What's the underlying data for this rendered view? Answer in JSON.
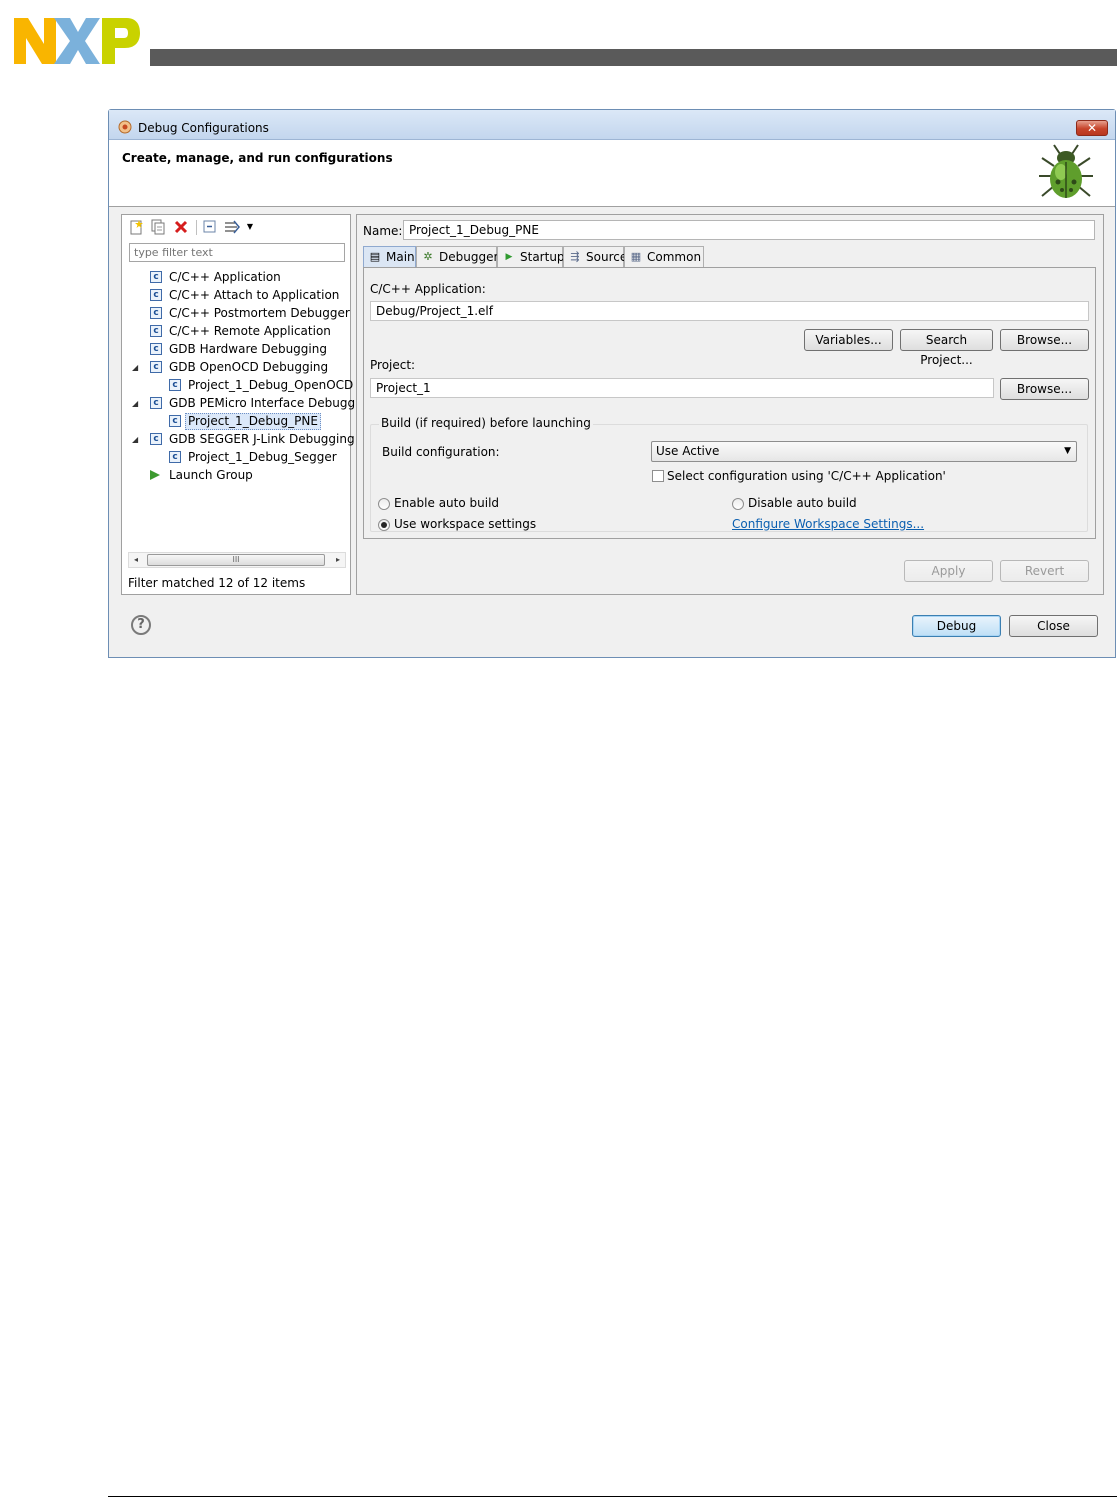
{
  "window": {
    "title": "Debug Configurations",
    "close_glyph": "✕",
    "banner_title": "Create, manage, and run configurations"
  },
  "filter": {
    "placeholder": "type filter text",
    "status": "Filter matched 12 of 12 items"
  },
  "tree": [
    {
      "label": "C/C++ Application",
      "level": 0,
      "icon": "c-config-icon",
      "expander": ""
    },
    {
      "label": "C/C++ Attach to Application",
      "level": 0,
      "icon": "c-config-icon",
      "expander": ""
    },
    {
      "label": "C/C++ Postmortem Debugger",
      "level": 0,
      "icon": "c-config-icon",
      "expander": ""
    },
    {
      "label": "C/C++ Remote Application",
      "level": 0,
      "icon": "c-config-icon",
      "expander": ""
    },
    {
      "label": "GDB Hardware Debugging",
      "level": 0,
      "icon": "c-config-icon",
      "expander": ""
    },
    {
      "label": "GDB OpenOCD Debugging",
      "level": 0,
      "icon": "c-config-icon",
      "expander": "◢"
    },
    {
      "label": "Project_1_Debug_OpenOCD",
      "level": 1,
      "icon": "c-config-icon",
      "expander": ""
    },
    {
      "label": "GDB PEMicro Interface Debugging",
      "level": 0,
      "icon": "c-config-icon",
      "expander": "◢"
    },
    {
      "label": "Project_1_Debug_PNE",
      "level": 1,
      "icon": "c-config-icon",
      "expander": "",
      "selected": true
    },
    {
      "label": "GDB SEGGER J-Link Debugging",
      "level": 0,
      "icon": "c-config-icon",
      "expander": "◢"
    },
    {
      "label": "Project_1_Debug_Segger",
      "level": 1,
      "icon": "c-config-icon",
      "expander": ""
    },
    {
      "label": "Launch Group",
      "level": 0,
      "icon": "launch-group-icon",
      "expander": ""
    }
  ],
  "scroll": {
    "left": "◂",
    "right": "▸",
    "grip": "III"
  },
  "config": {
    "name_label": "Name:",
    "name_value": "Project_1_Debug_PNE",
    "tabs": [
      {
        "label": "Main",
        "icon": "main-tab-icon",
        "glyph": "▤"
      },
      {
        "label": "Debugger",
        "icon": "debugger-tab-icon",
        "glyph": "✲"
      },
      {
        "label": "Startup",
        "icon": "startup-tab-icon",
        "glyph": "▶"
      },
      {
        "label": "Source",
        "icon": "source-tab-icon",
        "glyph": "⇶"
      },
      {
        "label": "Common",
        "icon": "common-tab-icon",
        "glyph": "▦"
      }
    ],
    "app_label": "C/C++ Application:",
    "app_value": "Debug/Project_1.elf",
    "variables_btn": "Variables...",
    "search_project_btn": "Search Project...",
    "browse_btn": "Browse...",
    "project_label": "Project:",
    "project_value": "Project_1",
    "project_browse_btn": "Browse...",
    "build_group_title": "Build (if required) before launching",
    "build_config_label": "Build configuration:",
    "build_config_value": "Use Active",
    "select_config_label": "Select configuration using 'C/C++ Application'",
    "enable_auto_build": "Enable auto build",
    "disable_auto_build": "Disable auto build",
    "use_workspace_settings": "Use workspace settings",
    "configure_workspace_link": "Configure Workspace Settings...",
    "apply_btn": "Apply",
    "revert_btn": "Revert"
  },
  "footer": {
    "help_glyph": "?",
    "debug_btn": "Debug",
    "close_btn": "Close"
  },
  "colors": {
    "nxp_yellow": "#f9b500",
    "nxp_blue": "#7bb1db",
    "nxp_green": "#c9d200",
    "link": "#0b5fb0"
  }
}
